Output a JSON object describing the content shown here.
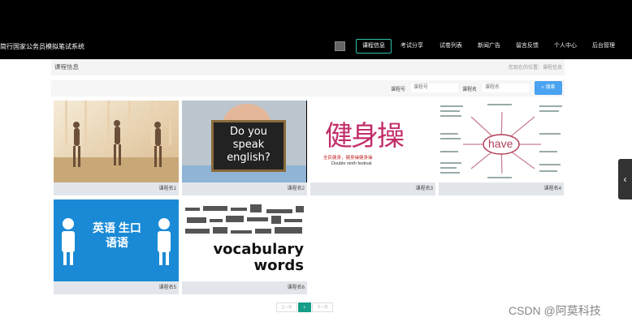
{
  "brand": "简行国家公务员模拟笔试系统",
  "nav": [
    "课程信息",
    "考试分享",
    "试卷列表",
    "新闻广告",
    "留言反馈",
    "个人中心",
    "后台管理"
  ],
  "page_title": "课程信息",
  "breadcrumb": {
    "label": "您现在的位置：",
    "current": "课程信息"
  },
  "search": {
    "field1_label": "课程号",
    "field1_placeholder": "课程号",
    "field2_label": "课程名",
    "field2_placeholder": "课程名",
    "button": "搜索"
  },
  "cards": [
    {
      "caption": "课程名1"
    },
    {
      "caption": "课程名2",
      "image_text": "Do you speak english?"
    },
    {
      "caption": "课程名3",
      "image_text": "健身操",
      "image_sub": "全民健身，健身操健身操",
      "image_sub2": "Double ninth festival"
    },
    {
      "caption": "课程名4",
      "image_text": "have"
    },
    {
      "caption": "课程名5",
      "image_text": "英语 生口 语语"
    },
    {
      "caption": "课程名6",
      "image_text": "vocabulary words"
    }
  ],
  "pager": {
    "prev": "上一页",
    "current": "1",
    "next": "下一页"
  },
  "watermark": "CSDN @阿莫科技",
  "sidetab_icon": "chevron-left-icon",
  "colors": {
    "accent": "#2fbfa8",
    "search_button": "#4aa3f0",
    "pager_current": "#169e88"
  }
}
